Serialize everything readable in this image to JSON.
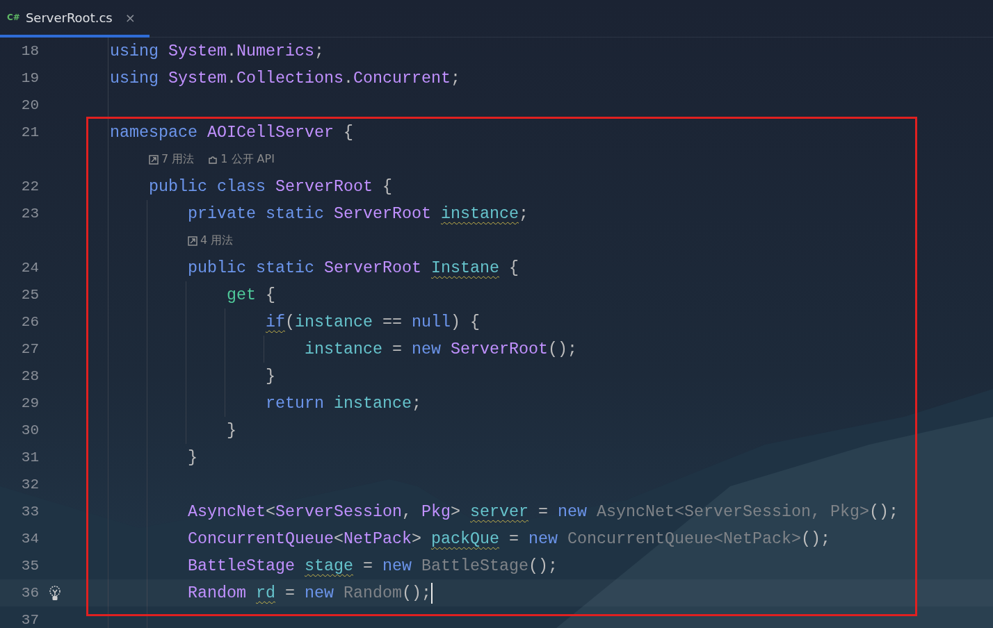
{
  "tab": {
    "badge": "C#",
    "title": "ServerRoot.cs",
    "close": "×",
    "selected": true
  },
  "rows": [
    {
      "kind": "code",
      "number": "18",
      "tokens": [
        {
          "kind": "kw",
          "text": "using ",
          "warn": false
        },
        {
          "kind": "ty",
          "text": "System",
          "warn": false
        },
        {
          "kind": "pu",
          "text": ".",
          "warn": false
        },
        {
          "kind": "ty",
          "text": "Numerics",
          "warn": false
        },
        {
          "kind": "pu",
          "text": ";",
          "warn": false
        }
      ]
    },
    {
      "kind": "code",
      "number": "19",
      "tokens": [
        {
          "kind": "kw",
          "text": "using ",
          "warn": false
        },
        {
          "kind": "ty",
          "text": "System",
          "warn": false
        },
        {
          "kind": "pu",
          "text": ".",
          "warn": false
        },
        {
          "kind": "ty",
          "text": "Collections",
          "warn": false
        },
        {
          "kind": "pu",
          "text": ".",
          "warn": false
        },
        {
          "kind": "ty",
          "text": "Concurrent",
          "warn": false
        },
        {
          "kind": "pu",
          "text": ";",
          "warn": false
        }
      ]
    },
    {
      "kind": "code",
      "number": "20"
    },
    {
      "kind": "code",
      "number": "21",
      "tokens": [
        {
          "kind": "kw",
          "text": "namespace ",
          "warn": false
        },
        {
          "kind": "ty",
          "text": "AOICellServer ",
          "warn": false
        },
        {
          "kind": "pu",
          "text": "{",
          "warn": false
        }
      ],
      "children": [
        {
          "kind": "hint",
          "items": [
            {
              "kind": "usages",
              "text": "7 用法"
            },
            {
              "kind": "api",
              "text": "1 公开 API"
            }
          ]
        },
        {
          "kind": "code",
          "number": "22",
          "tokens": [
            {
              "kind": "kw",
              "text": "public ",
              "warn": false
            },
            {
              "kind": "kw",
              "text": "class ",
              "warn": false
            },
            {
              "kind": "ty",
              "text": "ServerRoot ",
              "warn": false
            },
            {
              "kind": "pu",
              "text": "{",
              "warn": false
            }
          ],
          "children": [
            {
              "kind": "code",
              "number": "23",
              "tokens": [
                {
                  "kind": "kw",
                  "text": "private ",
                  "warn": false
                },
                {
                  "kind": "kw",
                  "text": "static ",
                  "warn": false
                },
                {
                  "kind": "ty",
                  "text": "ServerRoot ",
                  "warn": false
                },
                {
                  "kind": "fd",
                  "text": "instance",
                  "warn": true
                },
                {
                  "kind": "pu",
                  "text": ";",
                  "warn": false
                }
              ]
            },
            {
              "kind": "hint",
              "items": [
                {
                  "kind": "usages",
                  "text": "4 用法"
                }
              ]
            },
            {
              "kind": "code",
              "number": "24",
              "tokens": [
                {
                  "kind": "kw",
                  "text": "public ",
                  "warn": false
                },
                {
                  "kind": "kw",
                  "text": "static ",
                  "warn": false
                },
                {
                  "kind": "ty",
                  "text": "ServerRoot ",
                  "warn": false
                },
                {
                  "kind": "fd",
                  "text": "Instane",
                  "warn": true
                },
                {
                  "kind": "pu",
                  "text": " {",
                  "warn": false
                }
              ],
              "children": [
                {
                  "kind": "code",
                  "number": "25",
                  "tokens": [
                    {
                      "kind": "acc",
                      "text": "get ",
                      "warn": false
                    },
                    {
                      "kind": "pu",
                      "text": "{",
                      "warn": false
                    }
                  ],
                  "children": [
                    {
                      "kind": "code",
                      "number": "26",
                      "tokens": [
                        {
                          "kind": "kw",
                          "text": "if",
                          "warn": true
                        },
                        {
                          "kind": "pu",
                          "text": "(",
                          "warn": false
                        },
                        {
                          "kind": "fd",
                          "text": "instance ",
                          "warn": false
                        },
                        {
                          "kind": "pu",
                          "text": "== ",
                          "warn": false
                        },
                        {
                          "kind": "kw",
                          "text": "null",
                          "warn": false
                        },
                        {
                          "kind": "pu",
                          "text": ") {",
                          "warn": false
                        }
                      ],
                      "children": [
                        {
                          "kind": "code",
                          "number": "27",
                          "tokens": [
                            {
                              "kind": "fd",
                              "text": "instance ",
                              "warn": false
                            },
                            {
                              "kind": "pu",
                              "text": "= ",
                              "warn": false
                            },
                            {
                              "kind": "kw",
                              "text": "new ",
                              "warn": false
                            },
                            {
                              "kind": "ty",
                              "text": "ServerRoot",
                              "warn": false
                            },
                            {
                              "kind": "pu",
                              "text": "();",
                              "warn": false
                            }
                          ]
                        }
                      ]
                    },
                    {
                      "kind": "code",
                      "number": "28",
                      "tokens": [
                        {
                          "kind": "pu",
                          "text": "}",
                          "warn": false
                        }
                      ]
                    },
                    {
                      "kind": "code",
                      "number": "29",
                      "tokens": [
                        {
                          "kind": "kw",
                          "text": "return ",
                          "warn": false
                        },
                        {
                          "kind": "fd",
                          "text": "instance",
                          "warn": false
                        },
                        {
                          "kind": "pu",
                          "text": ";",
                          "warn": false
                        }
                      ]
                    }
                  ]
                },
                {
                  "kind": "code",
                  "number": "30",
                  "tokens": [
                    {
                      "kind": "pu",
                      "text": "}",
                      "warn": false
                    }
                  ]
                }
              ]
            },
            {
              "kind": "code",
              "number": "31",
              "tokens": [
                {
                  "kind": "pu",
                  "text": "}",
                  "warn": false
                }
              ]
            },
            {
              "kind": "code",
              "number": "32"
            },
            {
              "kind": "code",
              "number": "33",
              "tokens": [
                {
                  "kind": "ty",
                  "text": "AsyncNet",
                  "warn": false
                },
                {
                  "kind": "pu",
                  "text": "<",
                  "warn": false
                },
                {
                  "kind": "ty",
                  "text": "ServerSession",
                  "warn": false
                },
                {
                  "kind": "pu",
                  "text": ", ",
                  "warn": false
                },
                {
                  "kind": "ty",
                  "text": "Pkg",
                  "warn": false
                },
                {
                  "kind": "pu",
                  "text": "> ",
                  "warn": false
                },
                {
                  "kind": "fd",
                  "text": "server",
                  "warn": true
                },
                {
                  "kind": "pu",
                  "text": " = ",
                  "warn": false
                },
                {
                  "kind": "kw",
                  "text": "new ",
                  "warn": false
                },
                {
                  "kind": "dm",
                  "text": "AsyncNet<ServerSession, Pkg>",
                  "warn": false
                },
                {
                  "kind": "pu",
                  "text": "();",
                  "warn": false
                }
              ]
            },
            {
              "kind": "code",
              "number": "34",
              "tokens": [
                {
                  "kind": "ty",
                  "text": "ConcurrentQueue",
                  "warn": false
                },
                {
                  "kind": "pu",
                  "text": "<",
                  "warn": false
                },
                {
                  "kind": "ty",
                  "text": "NetPack",
                  "warn": false
                },
                {
                  "kind": "pu",
                  "text": "> ",
                  "warn": false
                },
                {
                  "kind": "fd",
                  "text": "packQue",
                  "warn": true
                },
                {
                  "kind": "pu",
                  "text": " = ",
                  "warn": false
                },
                {
                  "kind": "kw",
                  "text": "new ",
                  "warn": false
                },
                {
                  "kind": "dm",
                  "text": "ConcurrentQueue<NetPack>",
                  "warn": false
                },
                {
                  "kind": "pu",
                  "text": "();",
                  "warn": false
                }
              ]
            },
            {
              "kind": "code",
              "number": "35",
              "tokens": [
                {
                  "kind": "ty",
                  "text": "BattleStage ",
                  "warn": false
                },
                {
                  "kind": "fd",
                  "text": "stage",
                  "warn": true
                },
                {
                  "kind": "pu",
                  "text": " = ",
                  "warn": false
                },
                {
                  "kind": "kw",
                  "text": "new ",
                  "warn": false
                },
                {
                  "kind": "dm",
                  "text": "BattleStage",
                  "warn": false
                },
                {
                  "kind": "pu",
                  "text": "();",
                  "warn": false
                }
              ]
            },
            {
              "kind": "code",
              "number": "36",
              "current": true,
              "bulb": true,
              "caret": true,
              "tokens": [
                {
                  "kind": "ty",
                  "text": "Random ",
                  "warn": false
                },
                {
                  "kind": "fd",
                  "text": "rd",
                  "warn": true
                },
                {
                  "kind": "pu",
                  "text": " = ",
                  "warn": false
                },
                {
                  "kind": "kw",
                  "text": "new ",
                  "warn": false
                },
                {
                  "kind": "dm",
                  "text": "Random",
                  "warn": false
                },
                {
                  "kind": "pu",
                  "text": "();",
                  "warn": false
                }
              ]
            }
          ]
        }
      ]
    },
    {
      "kind": "code",
      "number": "37"
    }
  ]
}
